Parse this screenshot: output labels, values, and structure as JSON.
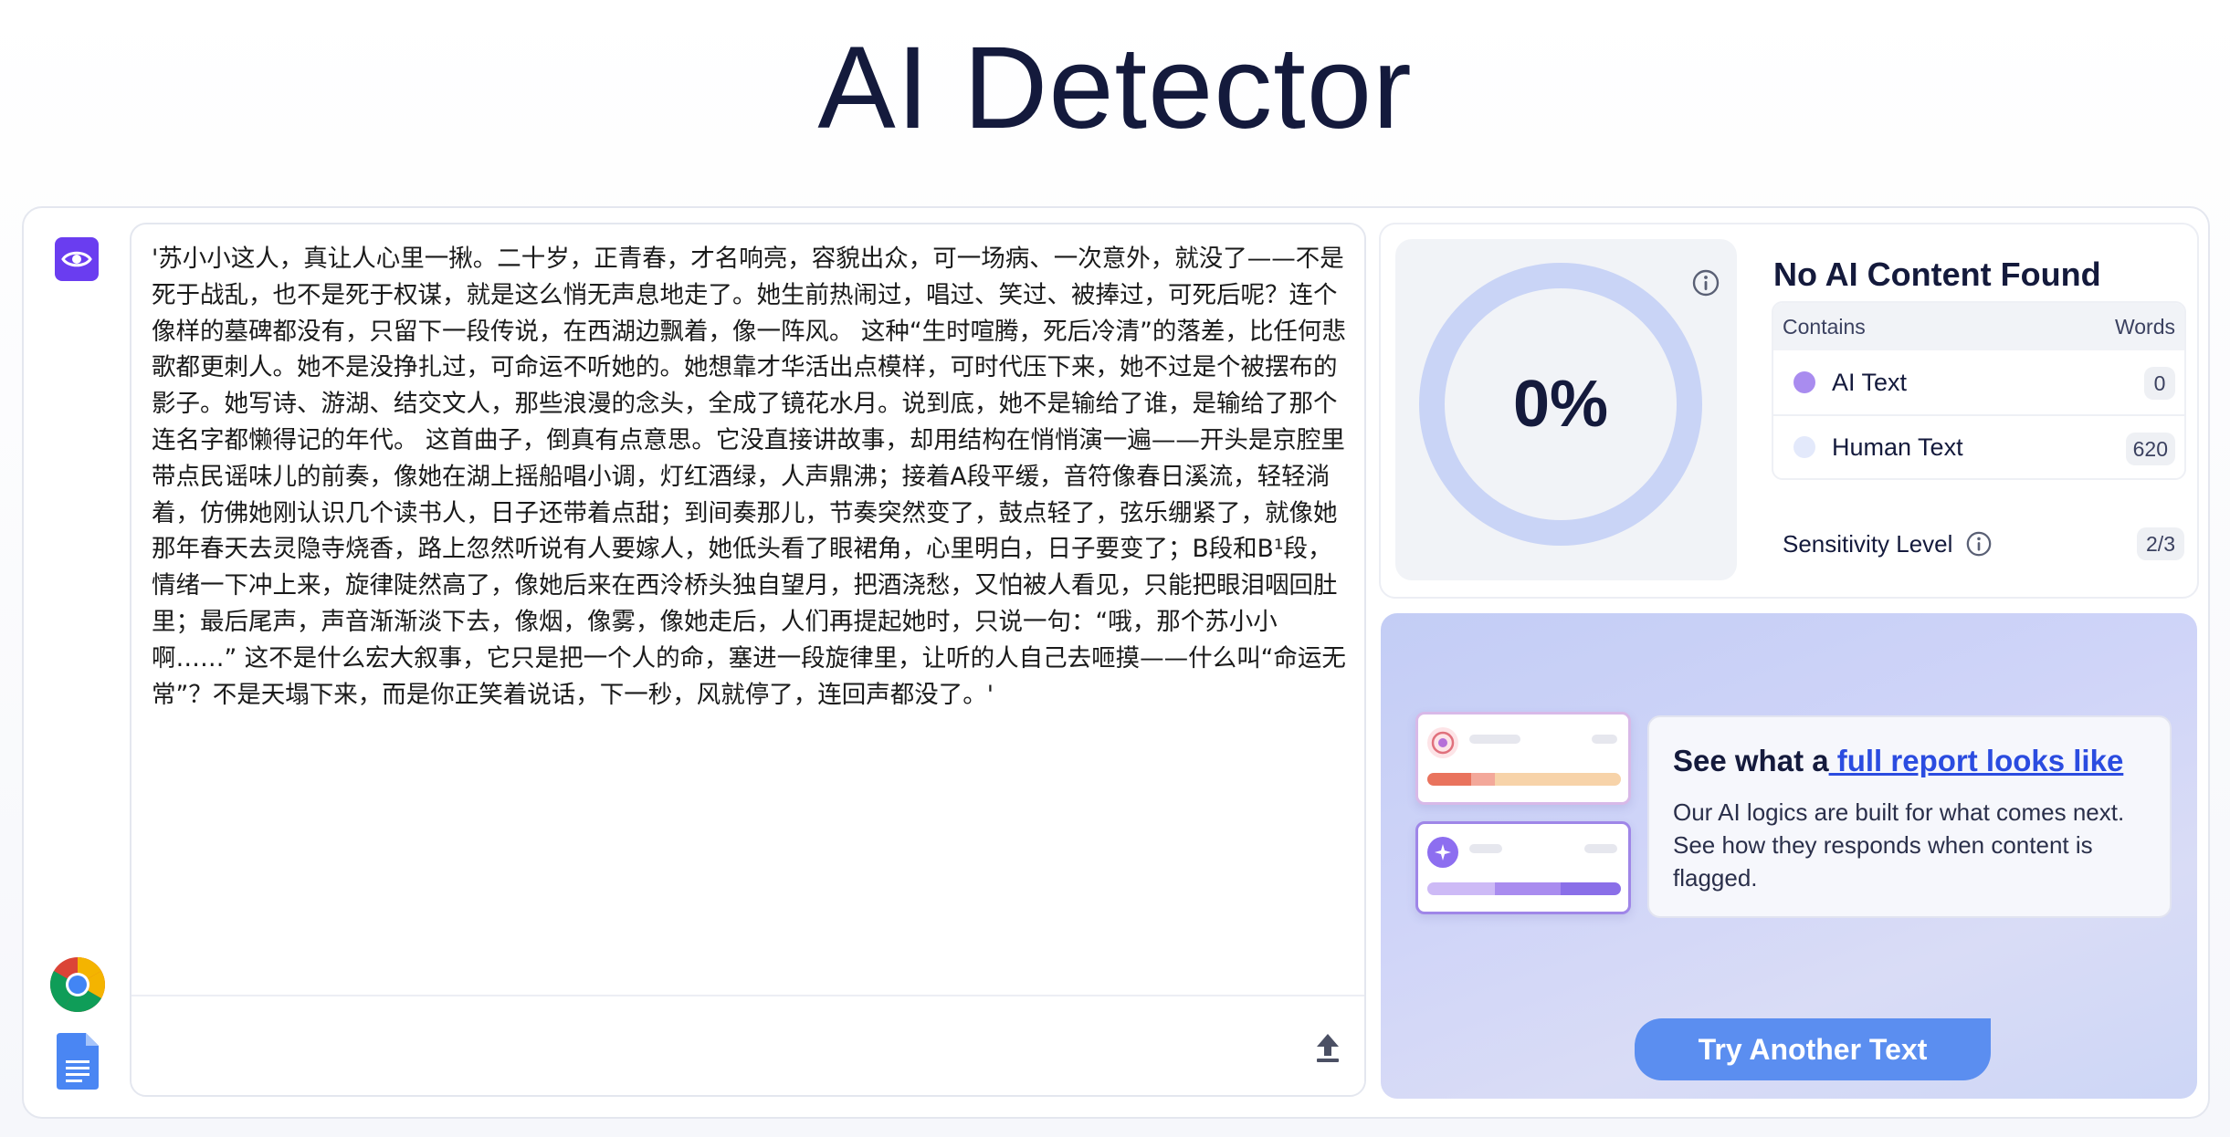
{
  "page": {
    "title": "AI Detector"
  },
  "input": {
    "text": "'苏小小这人，真让人心里一揪。二十岁，正青春，才名响亮，容貌出众，可一场病、一次意外，就没了——不是死于战乱，也不是死于权谋，就是这么悄无声息地走了。她生前热闹过，唱过、笑过、被捧过，可死后呢？连个像样的墓碑都没有，只留下一段传说，在西湖边飘着，像一阵风。 这种“生时喧腾，死后冷清”的落差，比任何悲歌都更刺人。她不是没挣扎过，可命运不听她的。她想靠才华活出点模样，可时代压下来，她不过是个被摆布的影子。她写诗、游湖、结交文人，那些浪漫的念头，全成了镜花水月。说到底，她不是输给了谁，是输给了那个连名字都懒得记的年代。 这首曲子，倒真有点意思。它没直接讲故事，却用结构在悄悄演一遍——开头是京腔里带点民谣味儿的前奏，像她在湖上摇船唱小调，灯红酒绿，人声鼎沸；接着A段平缓，音符像春日溪流，轻轻淌着，仿佛她刚认识几个读书人，日子还带着点甜；到间奏那儿，节奏突然变了，鼓点轻了，弦乐绷紧了，就像她那年春天去灵隐寺烧香，路上忽然听说有人要嫁人，她低头看了眼裙角，心里明白，日子要变了；B段和B¹段，情绪一下冲上来，旋律陡然高了，像她后来在西泠桥头独自望月，把酒浇愁，又怕被人看见，只能把眼泪咽回肚里；最后尾声，声音渐渐淡下去，像烟，像雾，像她走后，人们再提起她时，只说一句：“哦，那个苏小小啊……” 这不是什么宏大叙事，它只是把一个人的命，塞进一段旋律里，让听的人自己去咂摸——什么叫“命运无常”？不是天塌下来，而是你正笑着说话，下一秒，风就停了，连回声都没了。'"
  },
  "result": {
    "score": "0%",
    "score_fraction": 0,
    "title": "No AI Content Found",
    "table": {
      "col_contains": "Contains",
      "col_words": "Words",
      "rows": [
        {
          "label": "AI Text",
          "count": "0",
          "color": "#a98cef"
        },
        {
          "label": "Human Text",
          "count": "620",
          "color": "#e3e9fb"
        }
      ]
    },
    "sensitivity_label": "Sensitivity Level",
    "sensitivity_value": "2/3"
  },
  "promo": {
    "head_prefix": "See what a",
    "head_link": " full report looks like",
    "desc": "Our AI logics are built for what comes next. See how they responds when content is flagged.",
    "button": "Try Another Text"
  },
  "colors": {
    "accent": "#6a3df0",
    "ring": "#c9d4f6",
    "button": "#5b8ef0",
    "link": "#2b4ce0"
  },
  "icons": {
    "rail_top": "eye-icon",
    "rail_chrome": "chrome-icon",
    "rail_docs": "google-docs-icon",
    "upload": "upload-icon",
    "info": "info-icon"
  }
}
